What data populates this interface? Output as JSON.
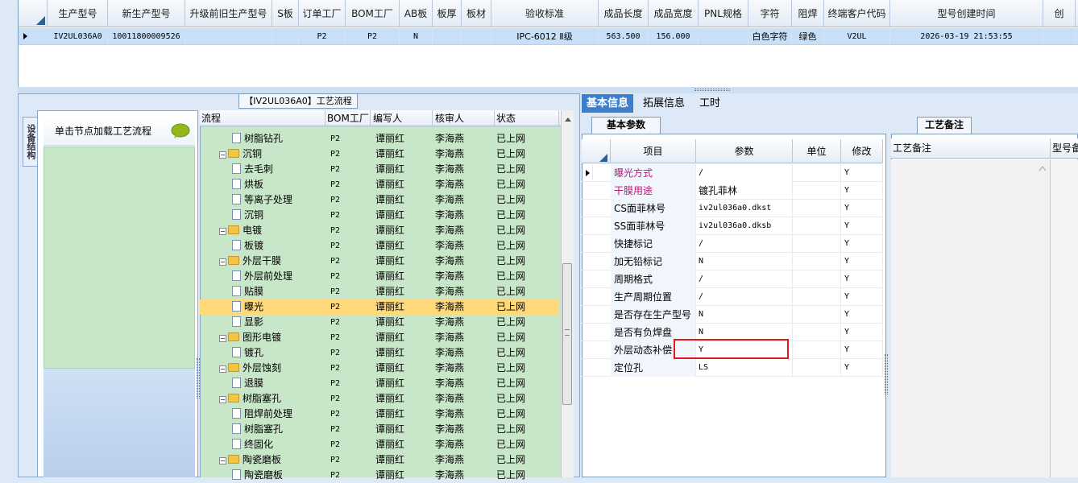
{
  "top_grid": {
    "columns": [
      "生产型号",
      "新生产型号",
      "升级前旧生产型号",
      "S板",
      "订单工厂",
      "BOM工厂",
      "AB板",
      "板厚",
      "板材",
      "验收标准",
      "成品长度",
      "成品宽度",
      "PNL规格",
      "字符",
      "阻焊",
      "终端客户代码",
      "型号创建时间",
      "创"
    ],
    "row": [
      "IV2UL036A0",
      "10011800009526",
      "",
      "",
      "P2",
      "P2",
      "N",
      "",
      "",
      "IPC-6012 Ⅱ级",
      "563.500",
      "156.000",
      "",
      "白色字符",
      "绿色",
      "V2UL",
      "2026-03-19 21:53:55",
      ""
    ]
  },
  "left": {
    "vertical_tab": "设备结构",
    "flow_title": "【IV2UL036A0】工艺流程",
    "node_hint": "单击节点加载工艺流程"
  },
  "tree": {
    "columns": [
      "流程",
      "BOM工厂",
      "编写人",
      "核审人",
      "状态"
    ],
    "rows": [
      {
        "level": 2,
        "kind": "doc",
        "name": "树脂钻孔",
        "bom": "P2",
        "author": "谭丽红",
        "reviewer": "李海燕",
        "status": "已上网"
      },
      {
        "level": 1,
        "kind": "folder",
        "name": "沉铜",
        "bom": "P2",
        "author": "谭丽红",
        "reviewer": "李海燕",
        "status": "已上网"
      },
      {
        "level": 2,
        "kind": "doc",
        "name": "去毛刺",
        "bom": "P2",
        "author": "谭丽红",
        "reviewer": "李海燕",
        "status": "已上网"
      },
      {
        "level": 2,
        "kind": "doc",
        "name": "烘板",
        "bom": "P2",
        "author": "谭丽红",
        "reviewer": "李海燕",
        "status": "已上网"
      },
      {
        "level": 2,
        "kind": "doc",
        "name": "等离子处理",
        "bom": "P2",
        "author": "谭丽红",
        "reviewer": "李海燕",
        "status": "已上网"
      },
      {
        "level": 2,
        "kind": "doc",
        "name": "沉铜",
        "bom": "P2",
        "author": "谭丽红",
        "reviewer": "李海燕",
        "status": "已上网"
      },
      {
        "level": 1,
        "kind": "folder",
        "name": "电镀",
        "bom": "P2",
        "author": "谭丽红",
        "reviewer": "李海燕",
        "status": "已上网"
      },
      {
        "level": 2,
        "kind": "doc",
        "name": "板镀",
        "bom": "P2",
        "author": "谭丽红",
        "reviewer": "李海燕",
        "status": "已上网"
      },
      {
        "level": 1,
        "kind": "folder",
        "name": "外层干膜",
        "bom": "P2",
        "author": "谭丽红",
        "reviewer": "李海燕",
        "status": "已上网"
      },
      {
        "level": 2,
        "kind": "doc",
        "name": "外层前处理",
        "bom": "P2",
        "author": "谭丽红",
        "reviewer": "李海燕",
        "status": "已上网"
      },
      {
        "level": 2,
        "kind": "doc",
        "name": "贴膜",
        "bom": "P2",
        "author": "谭丽红",
        "reviewer": "李海燕",
        "status": "已上网"
      },
      {
        "level": 2,
        "kind": "doc",
        "name": "曝光",
        "bom": "P2",
        "author": "谭丽红",
        "reviewer": "李海燕",
        "status": "已上网",
        "selected": true
      },
      {
        "level": 2,
        "kind": "doc",
        "name": "显影",
        "bom": "P2",
        "author": "谭丽红",
        "reviewer": "李海燕",
        "status": "已上网"
      },
      {
        "level": 1,
        "kind": "folder",
        "name": "图形电镀",
        "bom": "P2",
        "author": "谭丽红",
        "reviewer": "李海燕",
        "status": "已上网"
      },
      {
        "level": 2,
        "kind": "doc",
        "name": "镀孔",
        "bom": "P2",
        "author": "谭丽红",
        "reviewer": "李海燕",
        "status": "已上网"
      },
      {
        "level": 1,
        "kind": "folder",
        "name": "外层蚀刻",
        "bom": "P2",
        "author": "谭丽红",
        "reviewer": "李海燕",
        "status": "已上网"
      },
      {
        "level": 2,
        "kind": "doc",
        "name": "退膜",
        "bom": "P2",
        "author": "谭丽红",
        "reviewer": "李海燕",
        "status": "已上网"
      },
      {
        "level": 1,
        "kind": "folder",
        "name": "树脂塞孔",
        "bom": "P2",
        "author": "谭丽红",
        "reviewer": "李海燕",
        "status": "已上网"
      },
      {
        "level": 2,
        "kind": "doc",
        "name": "阻焊前处理",
        "bom": "P2",
        "author": "谭丽红",
        "reviewer": "李海燕",
        "status": "已上网"
      },
      {
        "level": 2,
        "kind": "doc",
        "name": "树脂塞孔",
        "bom": "P2",
        "author": "谭丽红",
        "reviewer": "李海燕",
        "status": "已上网"
      },
      {
        "level": 2,
        "kind": "doc",
        "name": "终固化",
        "bom": "P2",
        "author": "谭丽红",
        "reviewer": "李海燕",
        "status": "已上网"
      },
      {
        "level": 1,
        "kind": "folder",
        "name": "陶瓷磨板",
        "bom": "P2",
        "author": "谭丽红",
        "reviewer": "李海燕",
        "status": "已上网"
      },
      {
        "level": 2,
        "kind": "doc",
        "name": "陶瓷磨板",
        "bom": "P2",
        "author": "谭丽红",
        "reviewer": "李海燕",
        "status": "已上网"
      }
    ]
  },
  "right": {
    "tabs": [
      "基本信息",
      "拓展信息",
      "工时"
    ],
    "params_tab": "基本参数",
    "notes_tab": "工艺备注",
    "param_columns": [
      "项目",
      "参数",
      "单位",
      "修改"
    ],
    "params": [
      {
        "name": "曝光方式",
        "value": "/",
        "unit": "",
        "flag": "Y",
        "color": "#c0157a",
        "current": true
      },
      {
        "name": "干膜用途",
        "value": "镀孔菲林",
        "unit": "",
        "flag": "Y",
        "color": "#c0157a"
      },
      {
        "name": "CS面菲林号",
        "value": "iv2ul036a0.dkst",
        "unit": "",
        "flag": "Y"
      },
      {
        "name": "SS面菲林号",
        "value": "iv2ul036a0.dksb",
        "unit": "",
        "flag": "Y"
      },
      {
        "name": "快捷标记",
        "value": "/",
        "unit": "",
        "flag": "Y"
      },
      {
        "name": "加无铅标记",
        "value": "N",
        "unit": "",
        "flag": "Y"
      },
      {
        "name": "周期格式",
        "value": "/",
        "unit": "",
        "flag": "Y"
      },
      {
        "name": "生产周期位置",
        "value": "/",
        "unit": "",
        "flag": "Y"
      },
      {
        "name": "是否存在生产型号",
        "value": "N",
        "unit": "",
        "flag": "Y"
      },
      {
        "name": "是否有负焊盘",
        "value": "N",
        "unit": "",
        "flag": "Y"
      },
      {
        "name": "外层动态补偿",
        "value": "Y",
        "unit": "",
        "flag": "Y"
      },
      {
        "name": "定位孔",
        "value": "LS",
        "unit": "",
        "flag": "Y"
      }
    ],
    "notes_columns": [
      "工艺备注",
      "型号备"
    ]
  }
}
